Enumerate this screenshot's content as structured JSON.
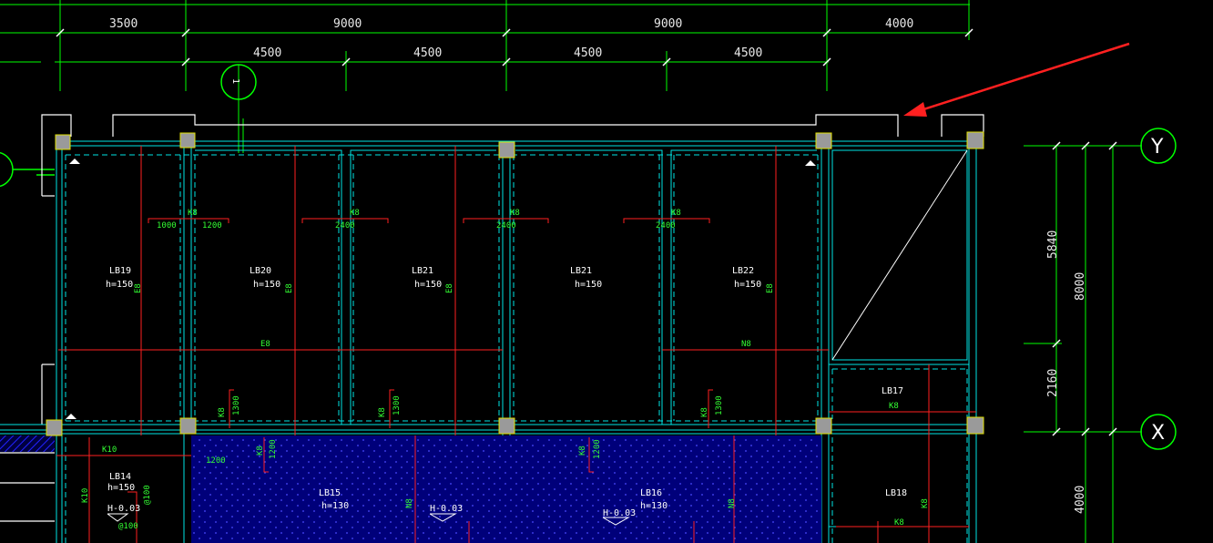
{
  "drawing": {
    "top_dimensions_row1": [
      "3500",
      "9000",
      "9000",
      "4000"
    ],
    "top_dimensions_row2": [
      "4500",
      "4500",
      "4500",
      "4500"
    ],
    "right_dimensions": [
      "5840",
      "8000",
      "2160",
      "4000"
    ],
    "axis_labels": [
      "Y",
      "X"
    ],
    "section_marker": "1",
    "colors": {
      "background": "#000000",
      "dimension_lines": "#00ff00",
      "beams": "#00ffff",
      "rebar": "#ff2020",
      "columns": "#9a9a9a",
      "hatch": "#1a1aff",
      "arrow": "#ff2020"
    },
    "slabs": [
      {
        "id": "LB19",
        "h": "h=150"
      },
      {
        "id": "LB20",
        "h": "h=150"
      },
      {
        "id": "LB21",
        "h": "h=150"
      },
      {
        "id": "LB21",
        "h": "h=150"
      },
      {
        "id": "LB22",
        "h": "h=150"
      },
      {
        "id": "LB17",
        "h": ""
      },
      {
        "id": "LB14",
        "h": "h=150"
      },
      {
        "id": "LB15",
        "h": "h=130"
      },
      {
        "id": "LB16",
        "h": "h=130"
      },
      {
        "id": "LB18",
        "h": ""
      }
    ],
    "rebar_labels": {
      "k8": "K8",
      "e8": "E8",
      "n8": "N8",
      "k10": "K10",
      "d1000": "1000",
      "d1200": "1200",
      "d2400": "2400",
      "d1300": "1300",
      "d100": "@100",
      "elev": "H-0.03"
    }
  }
}
